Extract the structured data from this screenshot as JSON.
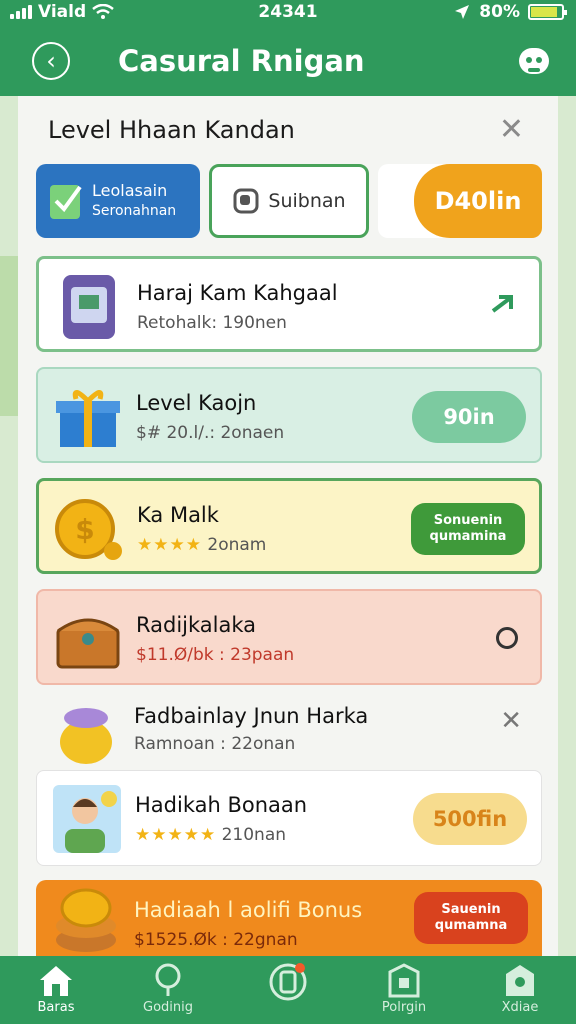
{
  "status": {
    "carrier": "Viald",
    "time": "24341",
    "battery": "80%"
  },
  "appbar": {
    "title": "Casural Rnigan"
  },
  "sheet": {
    "title": "Level Hhaan Kandan",
    "chips": [
      {
        "line1": "Leolasain",
        "line2": "Seronahnan"
      },
      {
        "label": "Suibnan"
      },
      {
        "label": "D40lin"
      }
    ],
    "rows": [
      {
        "name": "Haraj Kam Kahgaal",
        "sub": "Retohalk: 190nen"
      },
      {
        "name": "Level Kaojn",
        "sub": "$# 20.l/.: 2onaen",
        "action": "90in"
      },
      {
        "name": "Ka Malk",
        "stars": "★★★★",
        "sub": "2onam",
        "action1": "Sonuenin",
        "action2": "qumamina"
      },
      {
        "name": "Radijkalaka",
        "sub": "$11.Ø/bk : 23paan"
      },
      {
        "name": "Fadbainlay Jnun Harka",
        "sub": "Ramnoan : 22onan"
      },
      {
        "name": "Hadikah Bonaan",
        "stars": "★★★★★",
        "sub": "210nan",
        "action": "500fin"
      },
      {
        "name": "Hadiaah l aolifi Bonus",
        "sub": "$1525.Øk : 22gnan",
        "action1": "Sauenin",
        "action2": "qumamna"
      }
    ]
  },
  "nav": [
    {
      "label": "Baras"
    },
    {
      "label": "Godinig"
    },
    {
      "label": ""
    },
    {
      "label": "Polrgin"
    },
    {
      "label": "Xdiae"
    }
  ],
  "colors": {
    "primary": "#2f9a5c",
    "accent_orange": "#f0a31c",
    "chip_blue": "#2c74c0"
  }
}
